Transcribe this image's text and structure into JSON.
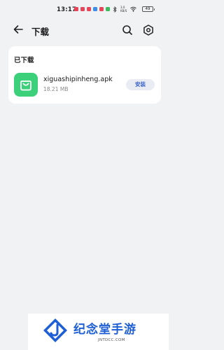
{
  "status_bar": {
    "time": "13:17",
    "network_top": "3.0",
    "network_bottom": "KB/S",
    "battery": "49",
    "notification_colors": [
      "#e8455a",
      "#e8455a",
      "#e8455a",
      "#3b8df0",
      "#e8455a",
      "#3dbb5c"
    ]
  },
  "header": {
    "title": "下载",
    "back_icon": "arrow-left-icon",
    "search_icon": "search-icon",
    "settings_icon": "gear-icon"
  },
  "downloads": {
    "section_title": "已下载",
    "items": [
      {
        "file_name": "xiguashipinheng.apk",
        "size": "18.21 MB",
        "action_label": "安装",
        "icon": "shopping-bag-icon",
        "icon_color": "#3dd07a"
      }
    ]
  },
  "watermark": {
    "brand": "纪念堂手游",
    "domain": "JNTDCC.COM",
    "color": "#1f5fd6"
  }
}
